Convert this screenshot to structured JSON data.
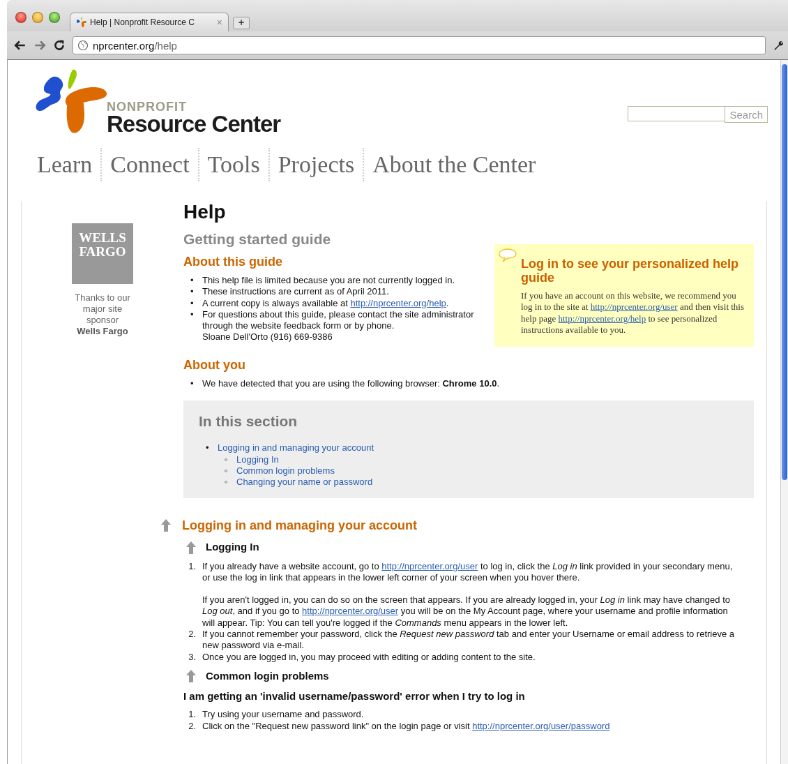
{
  "browser": {
    "tab_title": "Help | Nonprofit Resource C",
    "tab_close": "×",
    "new_tab": "+",
    "url_host": "nprcenter.org",
    "url_path": "/help"
  },
  "header": {
    "logo_small": "NONPROFIT",
    "logo_big": "Resource Center",
    "search": {
      "button": "Search"
    },
    "nav": [
      {
        "label": "Learn"
      },
      {
        "label": "Connect"
      },
      {
        "label": "Tools"
      },
      {
        "label": "Projects"
      },
      {
        "label": "About the Center"
      }
    ]
  },
  "sidebar": {
    "sponsor_logo": "WELLS FARGO",
    "caption": "Thanks to our major site sponsor",
    "sponsor_name": "Wells Fargo"
  },
  "login_box": {
    "title": "Log in to see your personalized help guide",
    "body": [
      {
        "kind": "text",
        "text": "If you have an account on this website, we recommend you log in to the site at "
      },
      {
        "kind": "link",
        "text": "http://nprcenter.org/user"
      },
      {
        "kind": "text",
        "text": " and then visit this help page "
      },
      {
        "kind": "link",
        "text": "http://nprcenter.org/help"
      },
      {
        "kind": "text",
        "text": " to see personalized instructions available to you."
      }
    ]
  },
  "main": {
    "title": "Help",
    "subtitle": "Getting started guide",
    "about_guide": {
      "heading": "About this guide",
      "items": [
        {
          "marker": "•",
          "parts": [
            {
              "kind": "text",
              "text": "This help file is limited because you are not currently logged in."
            }
          ]
        },
        {
          "marker": "•",
          "parts": [
            {
              "kind": "text",
              "text": "These instructions are current as of April 2011."
            }
          ]
        },
        {
          "marker": "•",
          "parts": [
            {
              "kind": "text",
              "text": "A current copy is always available at "
            },
            {
              "kind": "link",
              "text": "http://nprcenter.org/help"
            },
            {
              "kind": "text",
              "text": "."
            }
          ]
        },
        {
          "marker": "•",
          "parts": [
            {
              "kind": "text",
              "text": "For questions about this guide, please contact the site administrator through the website feedback form or by phone."
            },
            {
              "kind": "break"
            },
            {
              "kind": "text",
              "text": "Sloane Dell'Orto (916) 669-9386"
            }
          ]
        }
      ]
    },
    "about_you": {
      "heading": "About you",
      "items": [
        {
          "marker": "•",
          "parts": [
            {
              "kind": "text",
              "text": "We have detected that you are using the following browser: **Chrome 10.0**."
            }
          ]
        }
      ]
    },
    "toc": {
      "heading": "In this section",
      "items": [
        {
          "marker": "•",
          "label": "Logging in and managing your account",
          "children": [
            {
              "marker": "◦",
              "label": "Logging In"
            },
            {
              "marker": "◦",
              "label": "Common login problems"
            },
            {
              "marker": "◦",
              "label": "Changing your name or password"
            }
          ]
        }
      ]
    },
    "section": {
      "heading": "Logging in and managing your account",
      "subsections": [
        {
          "heading": "Logging In",
          "steps": [
            {
              "marker": "1.",
              "paras": [
                [
                  {
                    "kind": "text",
                    "text": "If you already have a website account, go to "
                  },
                  {
                    "kind": "link",
                    "text": "http://nprcenter.org/user"
                  },
                  {
                    "kind": "text",
                    "text": " to log in, click the *Log in* link provided in your secondary menu, or use the log in link that appears in the lower left corner of your screen when you hover there."
                  }
                ],
                [
                  {
                    "kind": "text",
                    "text": "If you aren't logged in, you can do so on the screen that appears. If you are already logged in, your *Log in* link may have changed to *Log out*, and if you go to "
                  },
                  {
                    "kind": "link",
                    "text": "http://nprcenter.org/user"
                  },
                  {
                    "kind": "text",
                    "text": " you will be on the My Account page, where your username and profile information will appear. Tip: You can tell you're logged if the *Commands* menu appears in the lower left."
                  }
                ]
              ]
            },
            {
              "marker": "2.",
              "paras": [
                [
                  {
                    "kind": "text",
                    "text": "If you cannot remember your password, click the *Request new password* tab and enter your Username or email address to retrieve a new password via e-mail."
                  }
                ]
              ]
            },
            {
              "marker": "3.",
              "paras": [
                [
                  {
                    "kind": "text",
                    "text": "Once you are logged in, you may proceed with editing or adding content to the site."
                  }
                ]
              ]
            }
          ]
        },
        {
          "heading": "Common login problems",
          "question": "I am getting an 'invalid username/password' error when I try to log in",
          "steps": [
            {
              "marker": "1.",
              "paras": [
                [
                  {
                    "kind": "text",
                    "text": "Try using your username and password."
                  }
                ]
              ]
            },
            {
              "marker": "2.",
              "paras": [
                [
                  {
                    "kind": "text",
                    "text": "Click on the \"Request new password link\" on the login page or visit "
                  },
                  {
                    "kind": "link",
                    "text": "http://nprcenter.org/user/password"
                  }
                ]
              ]
            }
          ]
        }
      ]
    }
  }
}
